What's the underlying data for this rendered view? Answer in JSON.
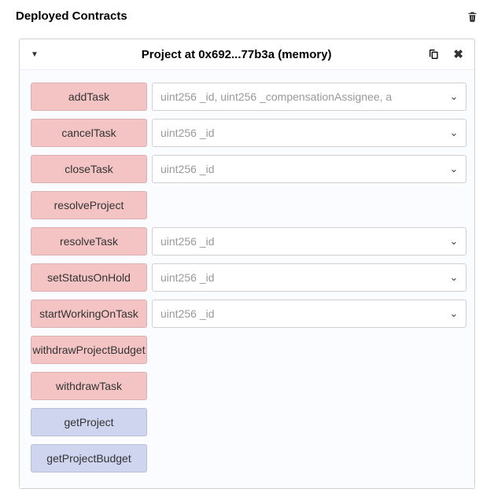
{
  "header": {
    "title": "Deployed Contracts"
  },
  "contract": {
    "title": "Project at 0x692...77b3a (memory)"
  },
  "functions": [
    {
      "name": "addTask",
      "kind": "write",
      "input": true,
      "placeholder": "uint256 _id, uint256 _compensationAssignee, a",
      "expand": true
    },
    {
      "name": "cancelTask",
      "kind": "write",
      "input": true,
      "placeholder": "uint256 _id",
      "expand": true
    },
    {
      "name": "closeTask",
      "kind": "write",
      "input": true,
      "placeholder": "uint256 _id",
      "expand": true
    },
    {
      "name": "resolveProject",
      "kind": "write",
      "input": false
    },
    {
      "name": "resolveTask",
      "kind": "write",
      "input": true,
      "placeholder": "uint256 _id",
      "expand": true
    },
    {
      "name": "setStatusOnHold",
      "kind": "write",
      "input": true,
      "placeholder": "uint256 _id",
      "expand": true
    },
    {
      "name": "startWorkingOnTask",
      "kind": "write",
      "input": true,
      "placeholder": "uint256 _id",
      "expand": true
    },
    {
      "name": "withdrawProjectBudget",
      "kind": "write",
      "input": false
    },
    {
      "name": "withdrawTask",
      "kind": "write",
      "input": false
    },
    {
      "name": "getProject",
      "kind": "read",
      "input": false
    },
    {
      "name": "getProjectBudget",
      "kind": "read",
      "input": false
    }
  ]
}
